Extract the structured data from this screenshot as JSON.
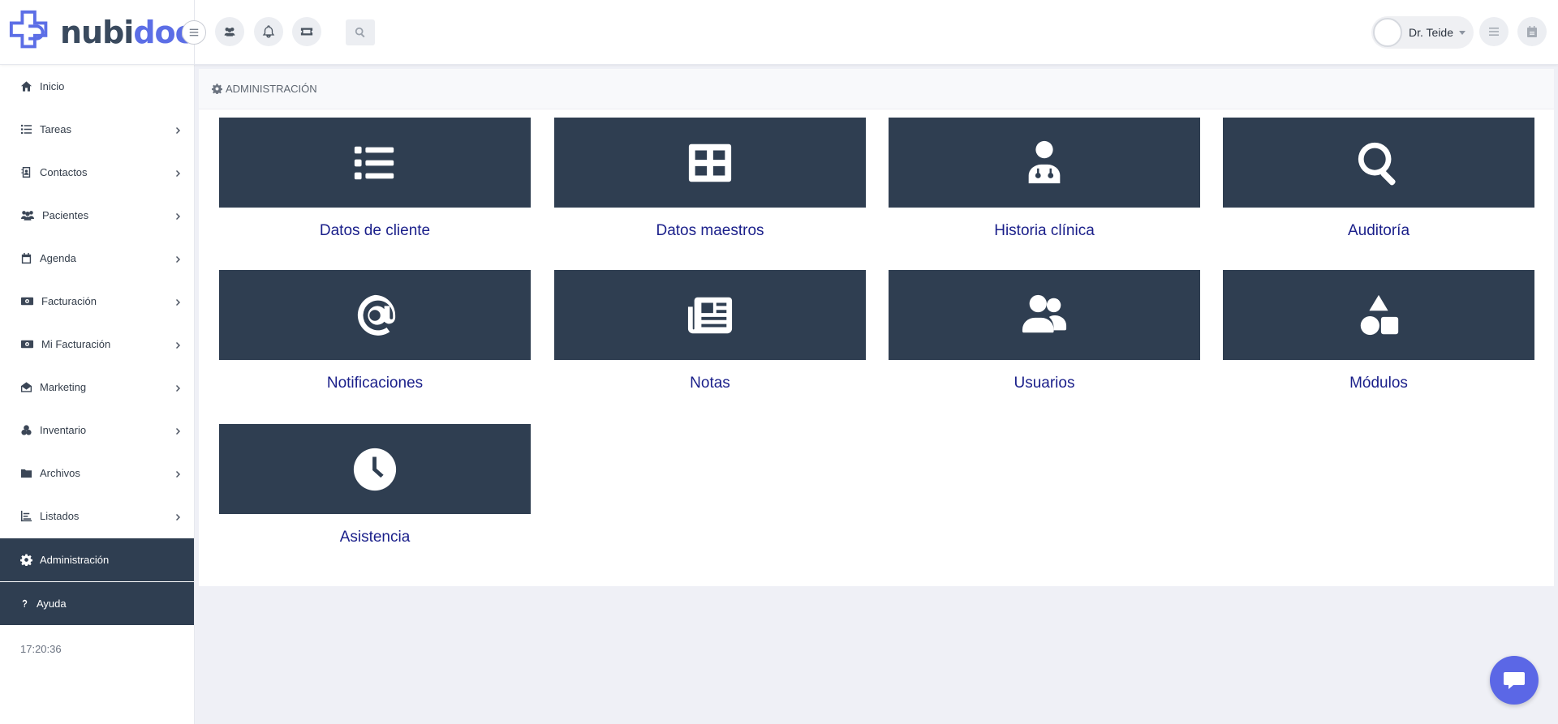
{
  "app": {
    "logo_part1": "nubi",
    "logo_part2": "doc",
    "brand_color": "#5c6ee6"
  },
  "header": {
    "icons": [
      "menu-toggle-icon",
      "users-icon",
      "bell-icon",
      "ticket-icon",
      "search-icon"
    ],
    "user_name": "Dr. Teide",
    "right_icons": [
      "list-icon",
      "calendar-icon"
    ]
  },
  "sidebar": {
    "items": [
      {
        "label": "Inicio",
        "icon": "home-icon",
        "has_children": false
      },
      {
        "label": "Tareas",
        "icon": "list-icon",
        "has_children": true
      },
      {
        "label": "Contactos",
        "icon": "address-book-icon",
        "has_children": true
      },
      {
        "label": "Pacientes",
        "icon": "users-icon",
        "has_children": true
      },
      {
        "label": "Agenda",
        "icon": "calendar-icon",
        "has_children": true
      },
      {
        "label": "Facturación",
        "icon": "money-icon",
        "has_children": true
      },
      {
        "label": "Mi Facturación",
        "icon": "money-icon",
        "has_children": true
      },
      {
        "label": "Marketing",
        "icon": "envelope-open-icon",
        "has_children": true
      },
      {
        "label": "Inventario",
        "icon": "boxes-icon",
        "has_children": true
      },
      {
        "label": "Archivos",
        "icon": "folder-icon",
        "has_children": true
      },
      {
        "label": "Listados",
        "icon": "chart-icon",
        "has_children": true
      },
      {
        "label": "Administración",
        "icon": "gear-icon",
        "has_children": false,
        "active": true
      },
      {
        "label": "Ayuda",
        "icon": "question-icon",
        "has_children": false
      }
    ],
    "clock": "17:20:36"
  },
  "main": {
    "breadcrumb": "ADMINISTRACIÓN",
    "tile_color": "#2f3e51",
    "tiles": [
      {
        "label": "Datos de cliente",
        "icon": "list-icon"
      },
      {
        "label": "Datos maestros",
        "icon": "table-icon"
      },
      {
        "label": "Historia clínica",
        "icon": "doctor-icon"
      },
      {
        "label": "Auditoría",
        "icon": "search-icon"
      },
      {
        "label": "Notificaciones",
        "icon": "at-icon"
      },
      {
        "label": "Notas",
        "icon": "newspaper-icon"
      },
      {
        "label": "Usuarios",
        "icon": "users-icon"
      },
      {
        "label": "Módulos",
        "icon": "shapes-icon"
      },
      {
        "label": "Asistencia",
        "icon": "clock-icon"
      }
    ]
  },
  "chat": {
    "icon": "chat-icon"
  }
}
